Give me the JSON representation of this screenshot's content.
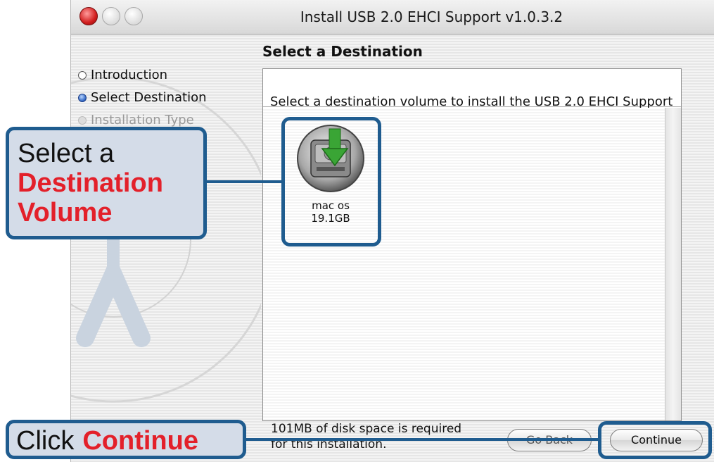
{
  "window": {
    "title": "Install USB 2.0 EHCI Support v1.0.3.2",
    "heading": "Select a Destination"
  },
  "sidebar": {
    "steps": [
      {
        "label": "Introduction",
        "state": "completed"
      },
      {
        "label": "Select Destination",
        "state": "current"
      },
      {
        "label": "Installation Type",
        "state": "upcoming"
      }
    ]
  },
  "main": {
    "instructions": "Select a destination volume to install the USB 2.0 EHCI Support",
    "volumes": [
      {
        "name": "mac os",
        "size": "19.1GB",
        "icon": "hard-drive-icon"
      }
    ]
  },
  "footer": {
    "disk_space_line1": "101MB of disk space is required",
    "disk_space_line2": "for this installation.",
    "go_back_label": "Go Back",
    "continue_label": "Continue"
  },
  "callouts": {
    "volume": {
      "line1": "Select a",
      "line2": "Destination",
      "line3": "Volume"
    },
    "continue": {
      "text": "Click",
      "emphasis": "Continue"
    }
  },
  "colors": {
    "callout_border": "#1f5c8f",
    "callout_fill": "#d4dce8",
    "callout_accent": "#e3202a"
  }
}
